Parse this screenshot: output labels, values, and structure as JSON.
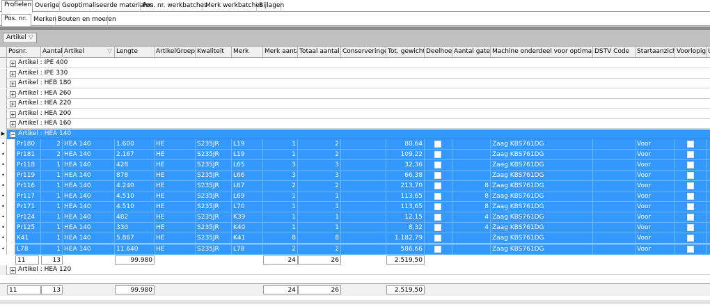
{
  "tabs_main": [
    "Profielen",
    "Overige",
    "Geoptimaliseerde materialen",
    "Pos. nr. werkbatches",
    "Merk werkbatches",
    "Bijlagen"
  ],
  "tabs_sub": [
    "Pos. nr.",
    "Merken",
    "Bouten en moeren"
  ],
  "group_by": {
    "label": "Artikel",
    "filter_icon": "filter-icon"
  },
  "columns": [
    "Posnr.",
    "Aantal",
    "Artikel",
    "Lengte",
    "ArtikelGroep",
    "Kwaliteit",
    "Merk",
    "Merk aantal",
    "Totaal aantal",
    "Conserveringen",
    "Tot. gewicht",
    "Deelhoek",
    "Aantal gaten",
    "Machine onderdeel voor optimalisatie",
    "DSTV Code",
    "Startaanzicht",
    "Voorlopig",
    "U"
  ],
  "groups_before": [
    "Artikel : IPE 400",
    "Artikel : IPE 330",
    "Artikel : HEB  180",
    "Artikel : HEA  260",
    "Artikel : HEA  220",
    "Artikel : HEA  200",
    "Artikel : HEA  160"
  ],
  "selected_group": "Artikel : HEA  140",
  "rows": [
    [
      "Pr180",
      "2",
      "HEA  140",
      "1.600",
      "HE",
      "S235JR",
      "L19",
      "1",
      "2",
      "",
      "80,64",
      "",
      "",
      "Zaag KBS761DG",
      "",
      "Voor",
      ""
    ],
    [
      "Pr181",
      "2",
      "HEA  140",
      "2.167",
      "HE",
      "S235JR",
      "L19",
      "1",
      "2",
      "",
      "109,22",
      "",
      "",
      "Zaag KBS761DG",
      "",
      "Voor",
      ""
    ],
    [
      "Pr118",
      "1",
      "HEA  140",
      "428",
      "HE",
      "S235JR",
      "L65",
      "3",
      "3",
      "",
      "32,36",
      "",
      "",
      "Zaag KBS761DG",
      "",
      "Voor",
      ""
    ],
    [
      "Pr119",
      "1",
      "HEA  140",
      "878",
      "HE",
      "S235JR",
      "L66",
      "3",
      "3",
      "",
      "66,38",
      "",
      "",
      "Zaag KBS761DG",
      "",
      "Voor",
      ""
    ],
    [
      "Pr116",
      "1",
      "HEA  140",
      "4.240",
      "HE",
      "S235JR",
      "L67",
      "2",
      "2",
      "",
      "213,70",
      "",
      "8",
      "Zaag KBS761DG",
      "",
      "Voor",
      ""
    ],
    [
      "Pr117",
      "1",
      "HEA  140",
      "4.510",
      "HE",
      "S235JR",
      "L69",
      "1",
      "1",
      "",
      "113,65",
      "",
      "8",
      "Zaag KBS761DG",
      "",
      "Voor",
      ""
    ],
    [
      "Pr171",
      "1",
      "HEA  140",
      "4.510",
      "HE",
      "S235JR",
      "L70",
      "1",
      "1",
      "",
      "113,65",
      "",
      "8",
      "Zaag KBS761DG",
      "",
      "Voor",
      ""
    ],
    [
      "Pr124",
      "1",
      "HEA  140",
      "482",
      "HE",
      "S235JR",
      "K39",
      "1",
      "1",
      "",
      "12,15",
      "",
      "4",
      "Zaag KBS761DG",
      "",
      "Voor",
      ""
    ],
    [
      "Pr125",
      "1",
      "HEA  140",
      "330",
      "HE",
      "S235JR",
      "K40",
      "1",
      "1",
      "",
      "8,32",
      "",
      "4",
      "Zaag KBS761DG",
      "",
      "Voor",
      ""
    ],
    [
      "K41",
      "1",
      "HEA  140",
      "5.867",
      "HE",
      "S235JR",
      "K41",
      "8",
      "8",
      "",
      "1.182,79",
      "",
      "",
      "Zaag KBS761DG",
      "",
      "Voor",
      ""
    ],
    [
      "L78",
      "1",
      "HEA  140",
      "11.640",
      "HE",
      "S235JR",
      "L78",
      "2",
      "2",
      "",
      "586,66",
      "",
      "",
      "Zaag KBS761DG",
      "",
      "Voor",
      ""
    ]
  ],
  "group_summary": {
    "count": "11",
    "aantal": "13",
    "lengte": "99.980",
    "merk_aantal": "24",
    "totaal_aantal": "26",
    "tot_gewicht": "2.519,50"
  },
  "groups_after": [
    "Artikel : HEA  120"
  ],
  "grand_summary": {
    "count": "11",
    "aantal": "13",
    "lengte": "99.980",
    "merk_aantal": "24",
    "totaal_aantal": "26",
    "tot_gewicht": "2.519,50"
  },
  "colors": {
    "selection": "#3398ff",
    "groupbar": "#c0c0c0"
  }
}
